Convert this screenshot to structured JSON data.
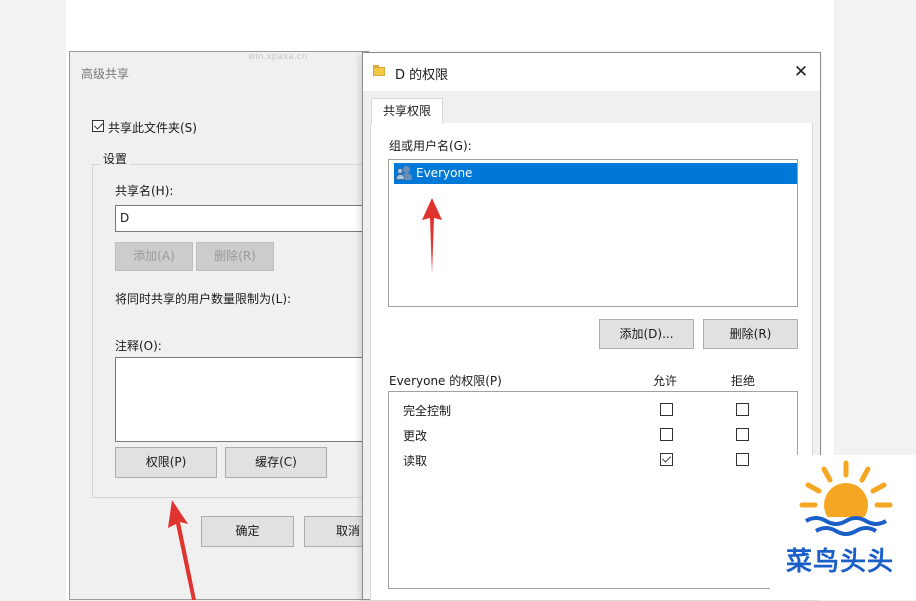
{
  "advanced_dialog": {
    "title": "高级共享",
    "share_checkbox_label": "共享此文件夹(S)",
    "share_checked": true,
    "settings_label": "设置",
    "share_name_label": "共享名(H):",
    "share_name_value": "D",
    "add_label": "添加(A)",
    "remove_label": "删除(R)",
    "limit_label": "将同时共享的用户数量限制为(L):",
    "comments_label": "注释(O):",
    "permissions_button": "权限(P)",
    "caching_button": "缓存(C)",
    "ok_button": "确定",
    "cancel_button": "取消",
    "watermark": "win.xpaxa.cn"
  },
  "perm_dialog": {
    "title": "D 的权限",
    "close_glyph": "✕",
    "tab_label": "共享权限",
    "group_label": "组或用户名(G):",
    "users": [
      "Everyone"
    ],
    "selected_user": "Everyone",
    "add_button": "添加(D)...",
    "remove_button": "删除(R)",
    "permissions_header": "Everyone 的权限(P)",
    "allow_header": "允许",
    "deny_header": "拒绝",
    "permissions": [
      {
        "name": "完全控制",
        "allow": false,
        "deny": false
      },
      {
        "name": "更改",
        "allow": false,
        "deny": false
      },
      {
        "name": "读取",
        "allow": true,
        "deny": false
      }
    ]
  },
  "logo": {
    "text": "菜鸟头头"
  },
  "colors": {
    "selection": "#0078d7",
    "annotation_arrow": "#e0322e",
    "logo_sun": "#f5a623",
    "logo_text": "#1a5fc8"
  }
}
